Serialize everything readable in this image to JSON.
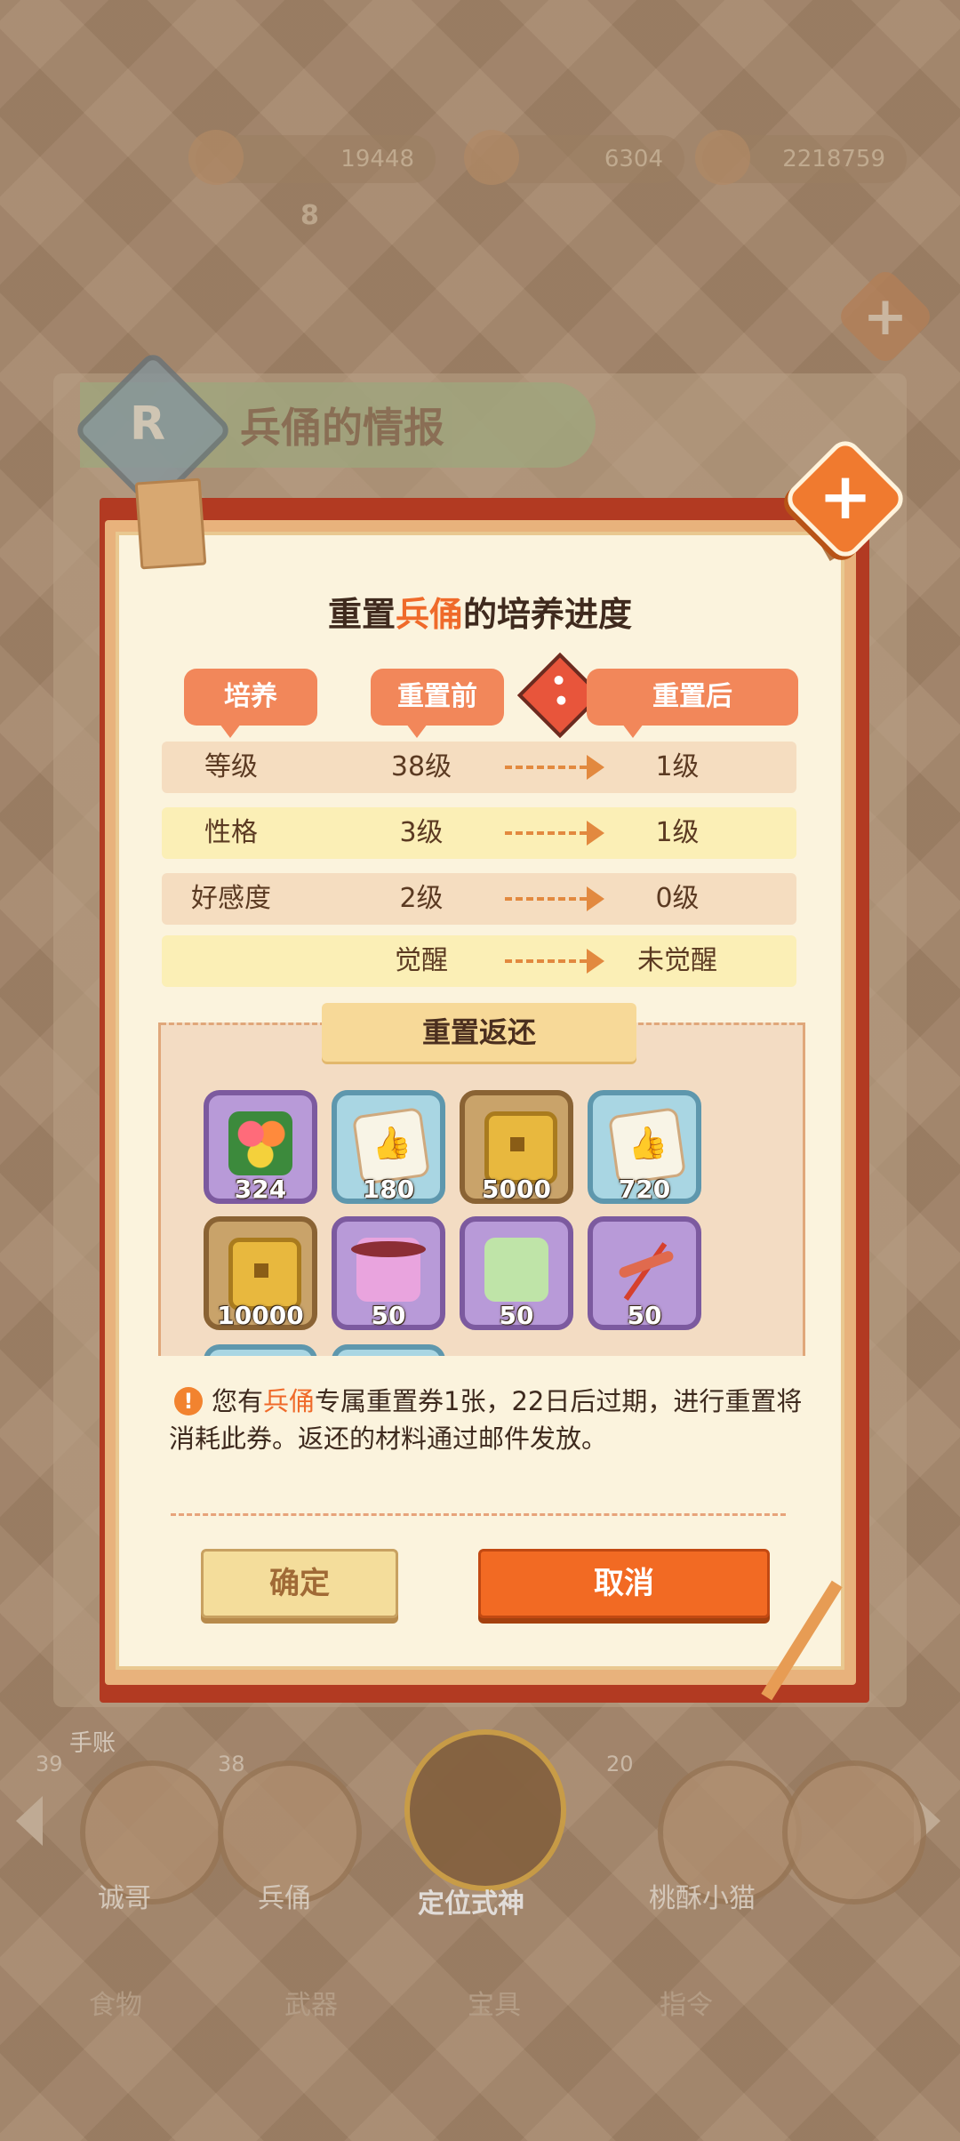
{
  "resources": {
    "r1": "19448",
    "r2": "6304",
    "r3": "2218759",
    "level": "8"
  },
  "background_panel": {
    "rarity": "R",
    "title": "兵俑的情报"
  },
  "dialog": {
    "title_prefix": "重置",
    "title_highlight": "兵俑",
    "title_suffix": "的培养进度",
    "headers": {
      "col1": "培养",
      "col2": "重置前",
      "col3": "重置后"
    },
    "rows": [
      {
        "key": "等级",
        "before": "38级",
        "after": "1级"
      },
      {
        "key": "性格",
        "before": "3级",
        "after": "1级"
      },
      {
        "key": "好感度",
        "before": "2级",
        "after": "0级"
      },
      {
        "key": "",
        "before": "觉醒",
        "after": "未觉醒"
      }
    ],
    "rewards_title": "重置返还",
    "rewards": [
      {
        "icon": "flower-bouquet-icon",
        "qty": "324"
      },
      {
        "icon": "like-card-icon",
        "qty": "180"
      },
      {
        "icon": "coin-icon",
        "qty": "5000"
      },
      {
        "icon": "like-card-icon",
        "qty": "720"
      },
      {
        "icon": "coin-icon",
        "qty": "10000"
      },
      {
        "icon": "pink-bug-icon",
        "qty": "50"
      },
      {
        "icon": "green-bug-icon",
        "qty": "50"
      },
      {
        "icon": "dragonfly-icon",
        "qty": "50"
      }
    ],
    "notice_prefix": "您有",
    "notice_highlight": "兵俑",
    "notice_rest": "专属重置券1张，22日后过期，进行重置将消耗此券。返还的材料通过邮件发放。",
    "confirm_label": "确定",
    "cancel_label": "取消"
  },
  "bottom": {
    "section_label": "手账",
    "characters": [
      {
        "name": "诚哥",
        "level": "39"
      },
      {
        "name": "兵俑",
        "level": "38"
      },
      {
        "name": "定位式神"
      },
      {
        "name": "桃酥小猫",
        "level": "20"
      }
    ],
    "tabs": [
      "食物",
      "武器",
      "宝具",
      "指令"
    ]
  }
}
